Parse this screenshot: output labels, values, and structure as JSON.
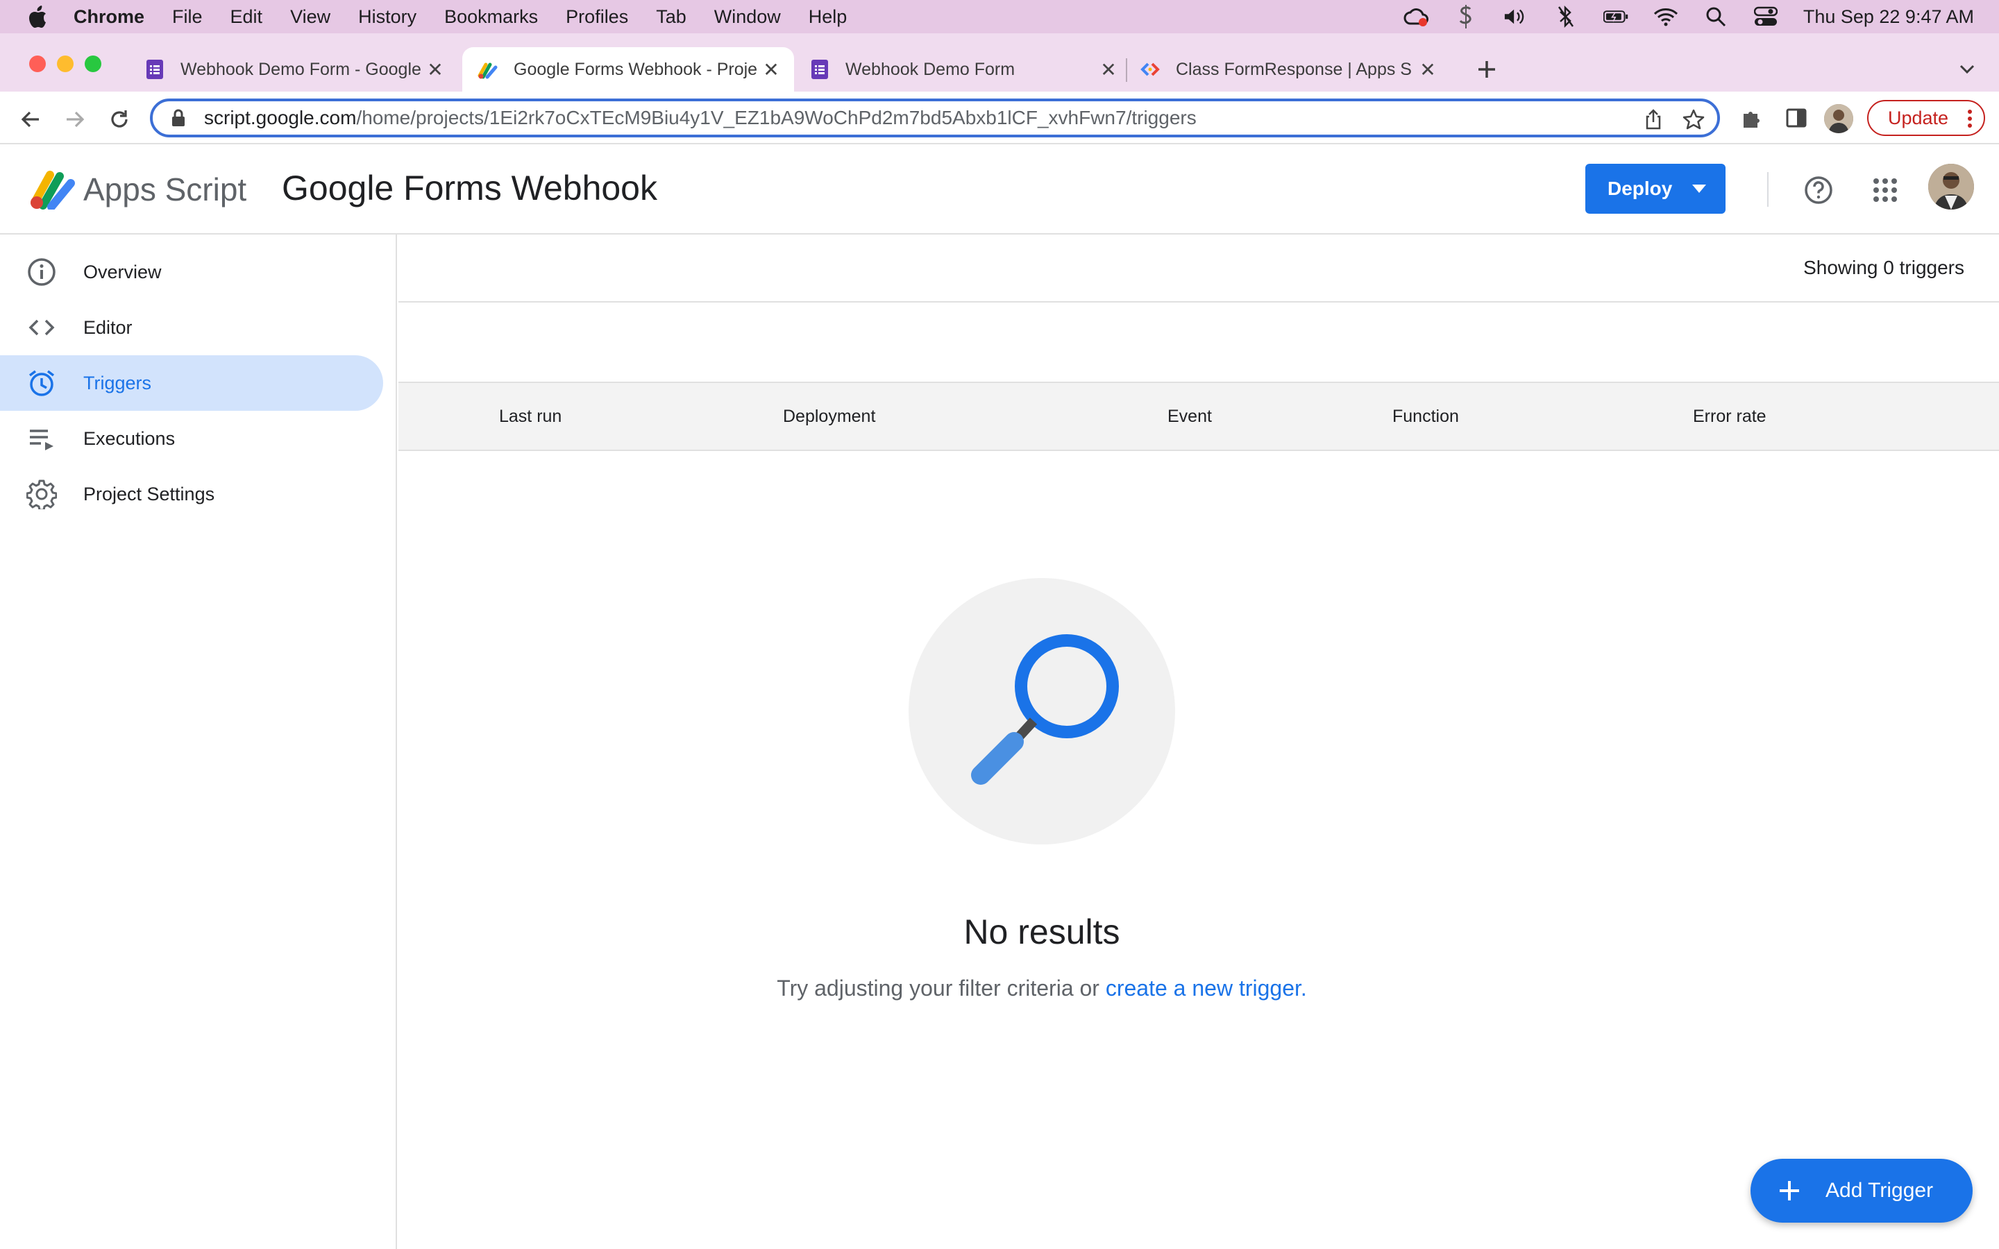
{
  "menubar": {
    "apple_icon": "apple-icon",
    "items": [
      "Chrome",
      "File",
      "Edit",
      "View",
      "History",
      "Bookmarks",
      "Profiles",
      "Tab",
      "Window",
      "Help"
    ],
    "clock": "Thu Sep 22  9:47 AM"
  },
  "tabs": [
    {
      "title": "Webhook Demo Form - Google",
      "favicon": "forms-icon",
      "active": false
    },
    {
      "title": "Google Forms Webhook - Proje",
      "favicon": "apps-script-icon",
      "active": true
    },
    {
      "title": "Webhook Demo Form",
      "favicon": "forms-icon",
      "active": false
    },
    {
      "title": "Class FormResponse  |  Apps S",
      "favicon": "google-developers-icon",
      "active": false
    }
  ],
  "omnibox": {
    "host": "script.google.com",
    "path": "/home/projects/1Ei2rk7oCxTEcM9Biu4y1V_EZ1bA9WoChPd2m7bd5Abxb1lCF_xvhFwn7/triggers"
  },
  "toolbar": {
    "update_label": "Update"
  },
  "header": {
    "app_name": "Apps Script",
    "project_name": "Google Forms Webhook",
    "deploy_label": "Deploy"
  },
  "sidebar": {
    "items": [
      {
        "label": "Overview",
        "icon": "info-icon",
        "active": false
      },
      {
        "label": "Editor",
        "icon": "code-icon",
        "active": false
      },
      {
        "label": "Triggers",
        "icon": "alarm-clock-icon",
        "active": true
      },
      {
        "label": "Executions",
        "icon": "playlist-play-icon",
        "active": false
      },
      {
        "label": "Project Settings",
        "icon": "gear-icon",
        "active": false
      }
    ]
  },
  "main": {
    "count_text": "Showing 0 triggers",
    "columns": [
      "Last run",
      "Deployment",
      "Event",
      "Function",
      "Error rate"
    ],
    "empty_title": "No results",
    "empty_sub_prefix": "Try adjusting your filter criteria or ",
    "empty_sub_link": "create a new trigger.",
    "add_trigger_label": "Add Trigger"
  },
  "colors": {
    "accent": "#1a73e8",
    "active_nav_bg": "#d2e3fc",
    "menubar_bg": "#e6c8e4",
    "tabstrip_bg": "#f0dcef"
  }
}
